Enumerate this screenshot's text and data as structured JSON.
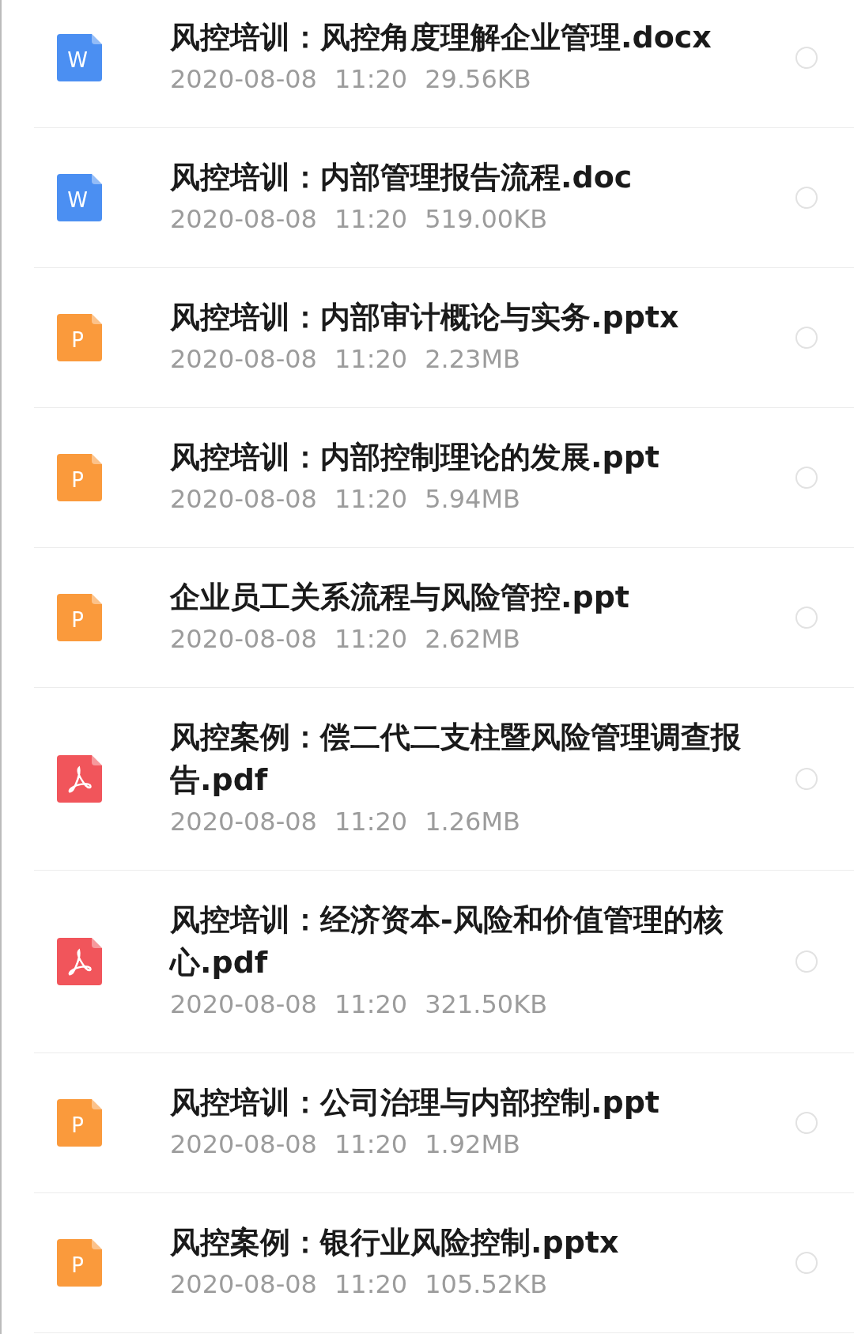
{
  "files": [
    {
      "kind": "word",
      "icon_text": "W",
      "name": "风控培训：风控角度理解企业管理.docx",
      "date": "2020-08-08",
      "time": "11:20",
      "size": "29.56KB",
      "selected": false
    },
    {
      "kind": "word",
      "icon_text": "W",
      "name": "风控培训：内部管理报告流程.doc",
      "date": "2020-08-08",
      "time": "11:20",
      "size": "519.00KB",
      "selected": false
    },
    {
      "kind": "ppt",
      "icon_text": "P",
      "name": "风控培训：内部审计概论与实务.pptx",
      "date": "2020-08-08",
      "time": "11:20",
      "size": "2.23MB",
      "selected": false
    },
    {
      "kind": "ppt",
      "icon_text": "P",
      "name": "风控培训：内部控制理论的发展.ppt",
      "date": "2020-08-08",
      "time": "11:20",
      "size": "5.94MB",
      "selected": false
    },
    {
      "kind": "ppt",
      "icon_text": "P",
      "name": "企业员工关系流程与风险管控.ppt",
      "date": "2020-08-08",
      "time": "11:20",
      "size": "2.62MB",
      "selected": false
    },
    {
      "kind": "pdf",
      "name": "风控案例：偿二代二支柱暨风险管理调查报告.pdf",
      "date": "2020-08-08",
      "time": "11:20",
      "size": "1.26MB",
      "selected": false
    },
    {
      "kind": "pdf",
      "name": "风控培训：经济资本-风险和价值管理的核心.pdf",
      "date": "2020-08-08",
      "time": "11:20",
      "size": "321.50KB",
      "selected": false
    },
    {
      "kind": "ppt",
      "icon_text": "P",
      "name": "风控培训：公司治理与内部控制.ppt",
      "date": "2020-08-08",
      "time": "11:20",
      "size": "1.92MB",
      "selected": false
    },
    {
      "kind": "ppt",
      "icon_text": "P",
      "name": "风控案例：银行业风险控制.pptx",
      "date": "2020-08-08",
      "time": "11:20",
      "size": "105.52KB",
      "selected": false
    }
  ]
}
